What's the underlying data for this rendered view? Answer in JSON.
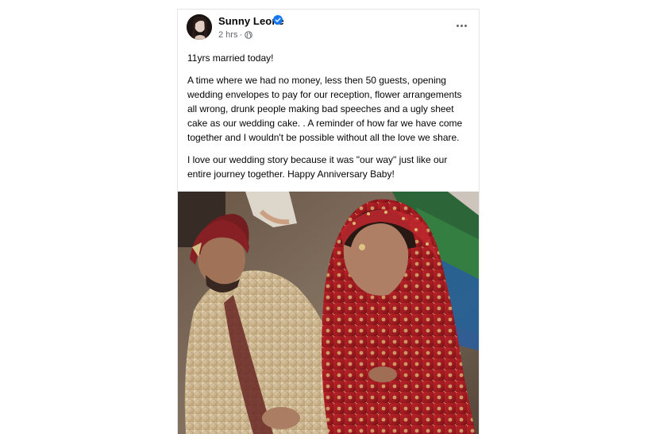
{
  "post": {
    "author": "Sunny Leone",
    "timestamp": "2 hrs",
    "separator": "·",
    "paragraphs": [
      "11yrs married today!",
      "A time where we had no money, less then 50 guests, opening wedding envelopes to pay for our reception, flower arrangements all wrong, drunk people making bad speeches and a ugly sheet cake as our wedding cake. . A reminder of how far we have come together and I wouldn't be possible without all the love we share.",
      "I love our wedding story because it was \"our way\" just like our entire journey together. Happy Anniversary Baby!"
    ],
    "icons": {
      "verified": "verified-badge-icon",
      "audience": "globe-icon",
      "more": "more-options-icon"
    }
  },
  "colors": {
    "verified_blue": "#1877f2",
    "text_primary": "#050505",
    "text_secondary": "#65676b"
  }
}
